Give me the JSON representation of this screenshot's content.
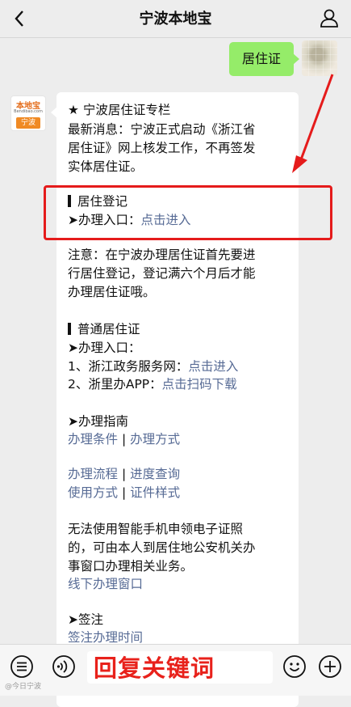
{
  "header": {
    "title": "宁波本地宝"
  },
  "chat": {
    "user_message": "居住证",
    "bot_avatar": {
      "brand": "本地宝",
      "url": "Bendibao.com",
      "city": "宁波"
    },
    "bot": {
      "section_title": "★ 宁波居住证专栏",
      "news_lines": [
        "最新消息：宁波正式启动《浙江省",
        "居住证》网上核发工作，不再签发",
        "实体居住证。"
      ],
      "reg_heading": "居住登记",
      "reg_entry_label": "➤办理入口：",
      "reg_entry_link": "点击进入",
      "note_lines": [
        "注意：在宁波办理居住证首先要进",
        "行居住登记，登记满六个月后才能",
        "办理居住证哦。"
      ],
      "normal_heading": "普通居住证",
      "normal_entry_label": "➤办理入口：",
      "item1_label": "1、浙江政务服务网：",
      "item1_link": "点击进入",
      "item2_label": "2、浙里办APP：",
      "item2_link": "点击扫码下载",
      "guide_label": "➤办理指南",
      "guide_row1": {
        "a": "办理条件",
        "sep": " | ",
        "b": "办理方式"
      },
      "guide_row2": {
        "a": "办理流程",
        "sep": " | ",
        "b": "进度查询"
      },
      "guide_row3": {
        "a": "使用方式",
        "sep": " | ",
        "b": "证件样式"
      },
      "offline_lines": [
        "无法使用智能手机申领电子证照",
        "的，可由本人到居住地公安机关办",
        "事窗口办理相关业务。"
      ],
      "offline_link": "线下办理窗口",
      "sign_label": "➤签注",
      "sign_link": "签注办理时间"
    }
  },
  "bottom_bar": {
    "overlay_text": "回复关键词"
  },
  "watermark": "@今日宁波",
  "colors": {
    "accent_red": "#e51b1b",
    "link": "#576b95",
    "bubble_green": "#95ec69"
  }
}
